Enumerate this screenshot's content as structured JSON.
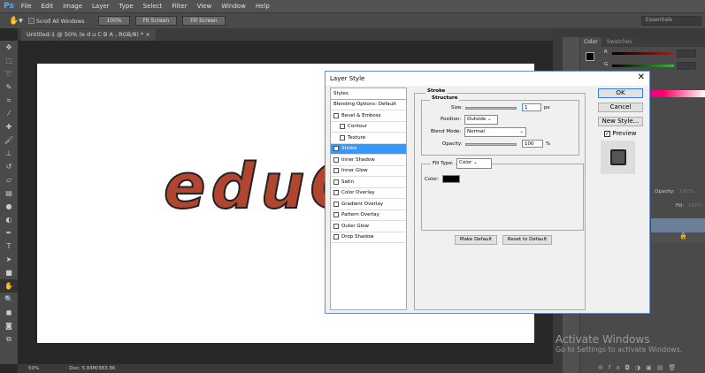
{
  "app": {
    "logo": "Ps",
    "menu": [
      "File",
      "Edit",
      "Image",
      "Layer",
      "Type",
      "Select",
      "Filter",
      "View",
      "Window",
      "Help"
    ]
  },
  "options": {
    "scroll_all": "Scroll All Windows",
    "btn_100": "100%",
    "fit_screen": "Fit Screen",
    "fill_screen": "Fill Screen",
    "workspace": "Essentials"
  },
  "document": {
    "tab": "Untitled-1 @ 50% (e d u C B A , RGB/8) *",
    "canvas_text": "eduC",
    "text_color": "#b04530"
  },
  "status": {
    "zoom": "50%",
    "doc": "Doc: 5.93M/383.8K"
  },
  "color_panel": {
    "tabs": [
      "Color",
      "Swatches"
    ],
    "channels": [
      "R",
      "G",
      "B"
    ],
    "values": [
      "0",
      "0",
      "0"
    ]
  },
  "layers_panel": {
    "opacity_label": "Opacity:",
    "opacity": "100%",
    "fill_label": "Fill:",
    "fill": "100%"
  },
  "watermark": {
    "title": "Activate Windows",
    "subtitle": "Go to Settings to activate Windows."
  },
  "dialog": {
    "title": "Layer Style",
    "styles_header": "Styles",
    "styles": [
      {
        "label": "Blending Options: Default",
        "check": false,
        "hasbox": false
      },
      {
        "label": "Bevel & Emboss",
        "check": false,
        "hasbox": true
      },
      {
        "label": "Contour",
        "check": false,
        "hasbox": true,
        "indent": true
      },
      {
        "label": "Texture",
        "check": false,
        "hasbox": true,
        "indent": true
      },
      {
        "label": "Stroke",
        "check": true,
        "hasbox": true,
        "selected": true
      },
      {
        "label": "Inner Shadow",
        "check": false,
        "hasbox": true
      },
      {
        "label": "Inner Glow",
        "check": false,
        "hasbox": true
      },
      {
        "label": "Satin",
        "check": false,
        "hasbox": true
      },
      {
        "label": "Color Overlay",
        "check": false,
        "hasbox": true
      },
      {
        "label": "Gradient Overlay",
        "check": false,
        "hasbox": true
      },
      {
        "label": "Pattern Overlay",
        "check": false,
        "hasbox": true
      },
      {
        "label": "Outer Glow",
        "check": false,
        "hasbox": true
      },
      {
        "label": "Drop Shadow",
        "check": false,
        "hasbox": true
      }
    ],
    "stroke": {
      "heading": "Stroke",
      "structure": "Structure",
      "size_label": "Size:",
      "size": "1",
      "size_unit": "px",
      "position_label": "Position:",
      "position": "Outside",
      "blend_label": "Blend Mode:",
      "blend": "Normal",
      "opacity_label": "Opacity:",
      "opacity": "100",
      "opacity_unit": "%",
      "fill_type_label": "Fill Type:",
      "fill_type": "Color",
      "color_label": "Color:",
      "color": "#000000",
      "make_default": "Make Default",
      "reset_default": "Reset to Default"
    },
    "buttons": {
      "ok": "OK",
      "cancel": "Cancel",
      "new_style": "New Style...",
      "preview": "Preview"
    }
  }
}
